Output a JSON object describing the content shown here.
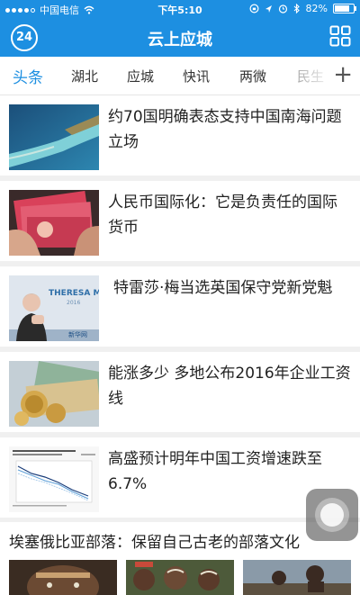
{
  "status": {
    "carrier": "中国电信",
    "time": "下午5:10",
    "battery": "82%",
    "battery_level": 0.82,
    "icons": [
      "signal-icon",
      "wifi-icon",
      "rotation-lock-icon",
      "location-icon",
      "alarm-icon",
      "bluetooth-icon",
      "battery-icon"
    ]
  },
  "header": {
    "logo": "24",
    "title": "云上应城"
  },
  "tabs": [
    "头条",
    "湖北",
    "应城",
    "快讯",
    "两微",
    "民生"
  ],
  "news": [
    {
      "headline": "约70国明确表态支持中国南海问题立场"
    },
    {
      "headline": "人民币国际化：它是负责任的国际货币"
    },
    {
      "headline": "特雷莎·梅当选英国保守党新党魁",
      "thumb_text": "THERESA MA",
      "thumb_sub": "2016",
      "thumb_logo": "新华网"
    },
    {
      "headline": "能涨多少 多地公布2016年企业工资线"
    },
    {
      "headline": "高盛预计明年中国工资增速跌至6.7%"
    }
  ],
  "feature": {
    "title": "埃塞俄比亚部落：保留自己古老的部落文化"
  },
  "colors": {
    "brand": "#1d8fe1",
    "text": "#222222",
    "divider": "#f0f0f0"
  }
}
